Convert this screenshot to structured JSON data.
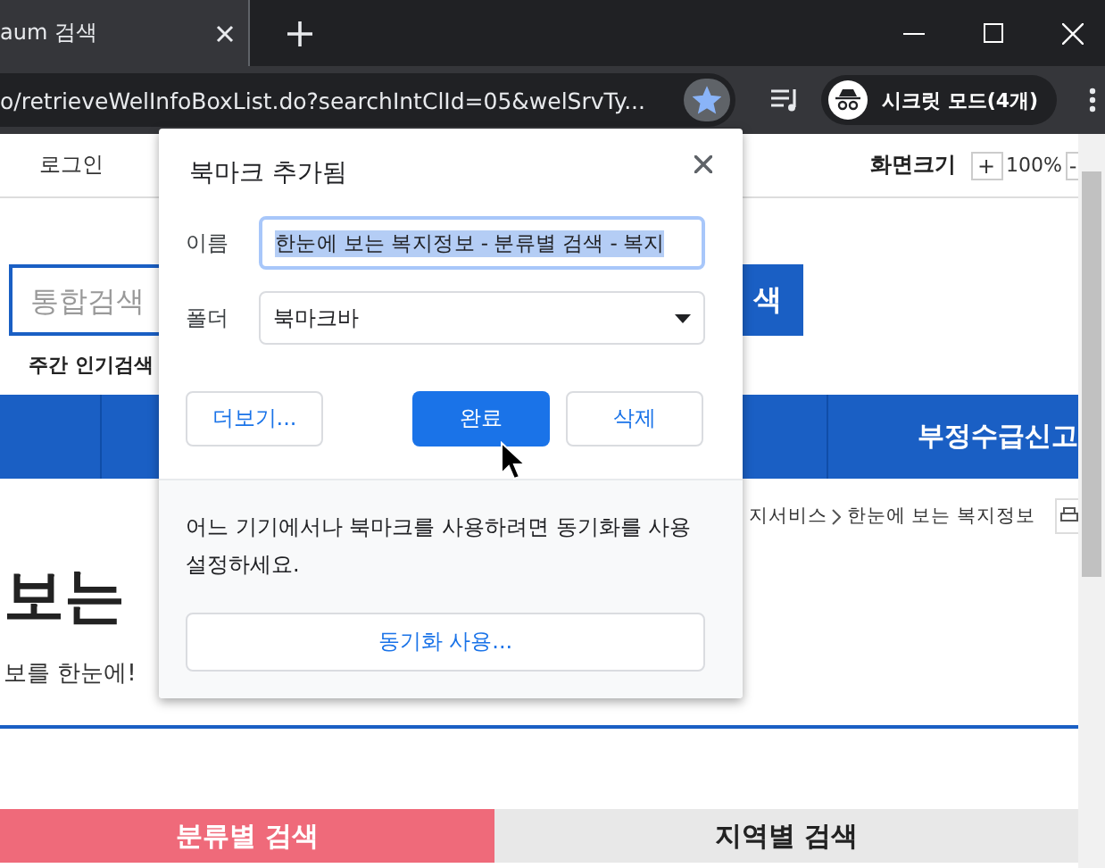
{
  "browser": {
    "tab": {
      "title": "aum 검색"
    },
    "url": "o/retrieveWelInfoBoxList.do?searchIntClId=05&welSrvTy...",
    "bookmarked": true,
    "profile": "시크릿 모드(4개)"
  },
  "page": {
    "top_links": [
      "로그인"
    ],
    "zoom_label": "화면크기",
    "zoom_plus": "+",
    "zoom_value": "100%",
    "zoom_minus": "-",
    "search": {
      "placeholder": "통합검색",
      "button": "색"
    },
    "popular_label": "주간 인기검색",
    "nav_items": [
      "부정수급신고"
    ],
    "breadcrumb": [
      "지서비스",
      "한눈에 보는 복지정보"
    ],
    "heading": "보는",
    "subtitle": "보를 한눈에!",
    "search_tabs": [
      {
        "label": "분류별 검색",
        "selected": true
      },
      {
        "label": "지역별 검색",
        "selected": false
      }
    ]
  },
  "dialog": {
    "title": "북마크 추가됨",
    "name_label": "이름",
    "name_value": "한눈에 보는 복지정보 - 분류별 검색 - 복지",
    "name_selected": true,
    "folder_label": "폴더",
    "folder_value": "북마크바",
    "buttons": [
      {
        "label": "더보기...",
        "kind": "secondary"
      },
      {
        "label": "완료",
        "kind": "primary"
      },
      {
        "label": "삭제",
        "kind": "secondary"
      }
    ],
    "footer_text": "어느 기기에서나 북마크를 사용하려면 동기화를 사용 설정하세요.",
    "sync_button": "동기화 사용..."
  }
}
